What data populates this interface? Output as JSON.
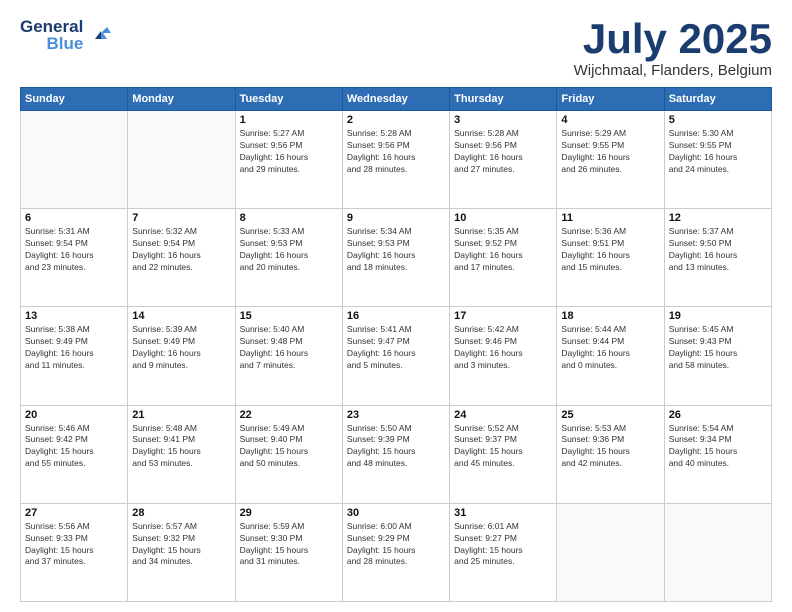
{
  "header": {
    "logo_line1": "General",
    "logo_line2": "Blue",
    "month": "July 2025",
    "location": "Wijchmaal, Flanders, Belgium"
  },
  "weekdays": [
    "Sunday",
    "Monday",
    "Tuesday",
    "Wednesday",
    "Thursday",
    "Friday",
    "Saturday"
  ],
  "weeks": [
    [
      {
        "day": "",
        "info": ""
      },
      {
        "day": "",
        "info": ""
      },
      {
        "day": "1",
        "info": "Sunrise: 5:27 AM\nSunset: 9:56 PM\nDaylight: 16 hours\nand 29 minutes."
      },
      {
        "day": "2",
        "info": "Sunrise: 5:28 AM\nSunset: 9:56 PM\nDaylight: 16 hours\nand 28 minutes."
      },
      {
        "day": "3",
        "info": "Sunrise: 5:28 AM\nSunset: 9:56 PM\nDaylight: 16 hours\nand 27 minutes."
      },
      {
        "day": "4",
        "info": "Sunrise: 5:29 AM\nSunset: 9:55 PM\nDaylight: 16 hours\nand 26 minutes."
      },
      {
        "day": "5",
        "info": "Sunrise: 5:30 AM\nSunset: 9:55 PM\nDaylight: 16 hours\nand 24 minutes."
      }
    ],
    [
      {
        "day": "6",
        "info": "Sunrise: 5:31 AM\nSunset: 9:54 PM\nDaylight: 16 hours\nand 23 minutes."
      },
      {
        "day": "7",
        "info": "Sunrise: 5:32 AM\nSunset: 9:54 PM\nDaylight: 16 hours\nand 22 minutes."
      },
      {
        "day": "8",
        "info": "Sunrise: 5:33 AM\nSunset: 9:53 PM\nDaylight: 16 hours\nand 20 minutes."
      },
      {
        "day": "9",
        "info": "Sunrise: 5:34 AM\nSunset: 9:53 PM\nDaylight: 16 hours\nand 18 minutes."
      },
      {
        "day": "10",
        "info": "Sunrise: 5:35 AM\nSunset: 9:52 PM\nDaylight: 16 hours\nand 17 minutes."
      },
      {
        "day": "11",
        "info": "Sunrise: 5:36 AM\nSunset: 9:51 PM\nDaylight: 16 hours\nand 15 minutes."
      },
      {
        "day": "12",
        "info": "Sunrise: 5:37 AM\nSunset: 9:50 PM\nDaylight: 16 hours\nand 13 minutes."
      }
    ],
    [
      {
        "day": "13",
        "info": "Sunrise: 5:38 AM\nSunset: 9:49 PM\nDaylight: 16 hours\nand 11 minutes."
      },
      {
        "day": "14",
        "info": "Sunrise: 5:39 AM\nSunset: 9:49 PM\nDaylight: 16 hours\nand 9 minutes."
      },
      {
        "day": "15",
        "info": "Sunrise: 5:40 AM\nSunset: 9:48 PM\nDaylight: 16 hours\nand 7 minutes."
      },
      {
        "day": "16",
        "info": "Sunrise: 5:41 AM\nSunset: 9:47 PM\nDaylight: 16 hours\nand 5 minutes."
      },
      {
        "day": "17",
        "info": "Sunrise: 5:42 AM\nSunset: 9:46 PM\nDaylight: 16 hours\nand 3 minutes."
      },
      {
        "day": "18",
        "info": "Sunrise: 5:44 AM\nSunset: 9:44 PM\nDaylight: 16 hours\nand 0 minutes."
      },
      {
        "day": "19",
        "info": "Sunrise: 5:45 AM\nSunset: 9:43 PM\nDaylight: 15 hours\nand 58 minutes."
      }
    ],
    [
      {
        "day": "20",
        "info": "Sunrise: 5:46 AM\nSunset: 9:42 PM\nDaylight: 15 hours\nand 55 minutes."
      },
      {
        "day": "21",
        "info": "Sunrise: 5:48 AM\nSunset: 9:41 PM\nDaylight: 15 hours\nand 53 minutes."
      },
      {
        "day": "22",
        "info": "Sunrise: 5:49 AM\nSunset: 9:40 PM\nDaylight: 15 hours\nand 50 minutes."
      },
      {
        "day": "23",
        "info": "Sunrise: 5:50 AM\nSunset: 9:39 PM\nDaylight: 15 hours\nand 48 minutes."
      },
      {
        "day": "24",
        "info": "Sunrise: 5:52 AM\nSunset: 9:37 PM\nDaylight: 15 hours\nand 45 minutes."
      },
      {
        "day": "25",
        "info": "Sunrise: 5:53 AM\nSunset: 9:36 PM\nDaylight: 15 hours\nand 42 minutes."
      },
      {
        "day": "26",
        "info": "Sunrise: 5:54 AM\nSunset: 9:34 PM\nDaylight: 15 hours\nand 40 minutes."
      }
    ],
    [
      {
        "day": "27",
        "info": "Sunrise: 5:56 AM\nSunset: 9:33 PM\nDaylight: 15 hours\nand 37 minutes."
      },
      {
        "day": "28",
        "info": "Sunrise: 5:57 AM\nSunset: 9:32 PM\nDaylight: 15 hours\nand 34 minutes."
      },
      {
        "day": "29",
        "info": "Sunrise: 5:59 AM\nSunset: 9:30 PM\nDaylight: 15 hours\nand 31 minutes."
      },
      {
        "day": "30",
        "info": "Sunrise: 6:00 AM\nSunset: 9:29 PM\nDaylight: 15 hours\nand 28 minutes."
      },
      {
        "day": "31",
        "info": "Sunrise: 6:01 AM\nSunset: 9:27 PM\nDaylight: 15 hours\nand 25 minutes."
      },
      {
        "day": "",
        "info": ""
      },
      {
        "day": "",
        "info": ""
      }
    ]
  ]
}
